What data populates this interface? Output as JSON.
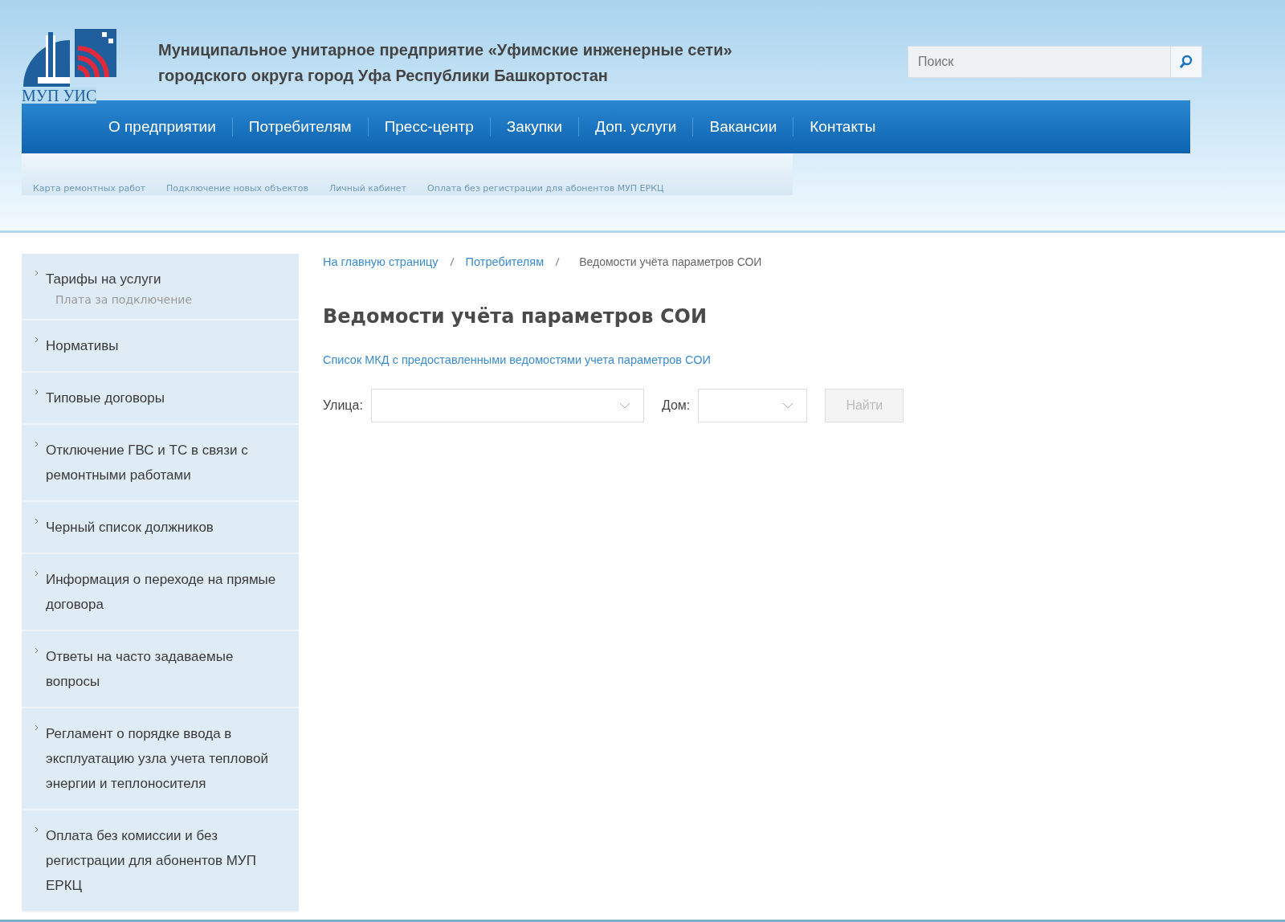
{
  "logo": {
    "text": "МУП УИС"
  },
  "org_name": [
    "Муниципальное унитарное предприятие «Уфимские инженерные сети»",
    "городского округа город Уфа Республики Башкортостан"
  ],
  "search": {
    "placeholder": "Поиск"
  },
  "nav": [
    "О предприятии",
    "Потребителям",
    "Пресс-центр",
    "Закупки",
    "Доп. услуги",
    "Вакансии",
    "Контакты"
  ],
  "subnav": [
    "Карта ремонтных работ",
    "Подключение новых объектов",
    "Личный кабинет",
    "Оплата без регистрации для абонентов МУП ЕРКЦ"
  ],
  "sidebar": {
    "items": [
      {
        "label": "Тарифы на услуги",
        "children": [
          {
            "label": "Плата за подключение"
          }
        ]
      },
      {
        "label": "Нормативы"
      },
      {
        "label": "Типовые договоры"
      },
      {
        "label": "Отключение ГВС и ТС в связи с ремонтными работами"
      },
      {
        "label": "Черный список должников"
      },
      {
        "label": "Информация о переходе на прямые договора"
      },
      {
        "label": "Ответы на часто задаваемые вопросы"
      },
      {
        "label": "Регламент о порядке ввода в эксплуатацию узла учета тепловой энергии и теплоносителя"
      },
      {
        "label": "Оплата без комиссии и без регистрации для абонентов МУП ЕРКЦ"
      }
    ]
  },
  "breadcrumb": [
    {
      "label": "На главную страницу",
      "kind": "link"
    },
    {
      "label": "Потребителям",
      "kind": "link"
    },
    {
      "label": "Ведомости учёта параметров СОИ",
      "kind": "current"
    }
  ],
  "page_title": "Ведомости учёта параметров СОИ",
  "list_link": "Список МКД с предоставленными ведомостями учета параметров СОИ",
  "form": {
    "street_label": "Улица:",
    "house_label": "Дом:",
    "submit": "Найти",
    "submit_disabled": true
  }
}
